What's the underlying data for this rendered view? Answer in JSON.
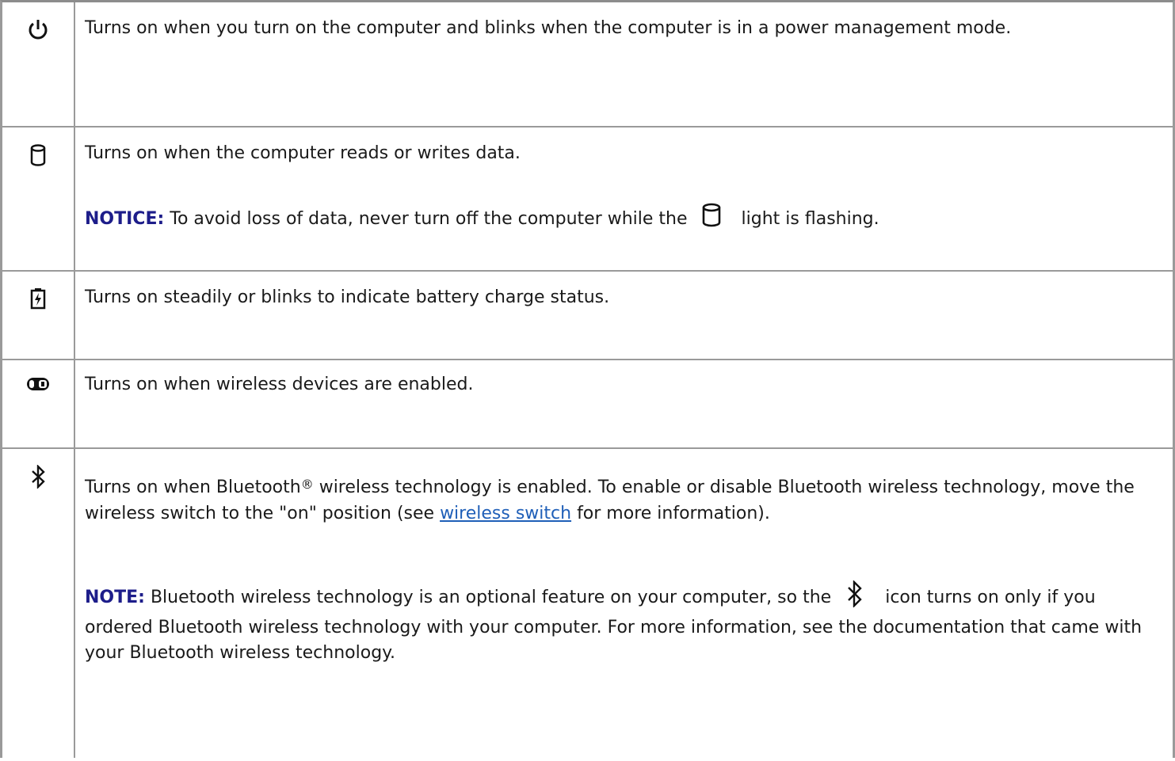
{
  "rows": [
    {
      "icon": "power-icon",
      "text": "Turns on when you turn on the computer and blinks when the computer is in a power management mode."
    },
    {
      "icon": "hard-drive-icon",
      "text": "Turns on when the computer reads or writes data.",
      "notice": {
        "label": "NOTICE:",
        "before": "To avoid loss of data, never turn off the computer while the",
        "inline_icon": "hard-drive-icon",
        "after": "light is flashing."
      }
    },
    {
      "icon": "battery-icon",
      "text": "Turns on steadily or blinks to indicate battery charge status."
    },
    {
      "icon": "wifi-icon",
      "text": "Turns on when wireless devices are enabled."
    },
    {
      "icon": "bluetooth-icon",
      "text_start": "Turns on when Bluetooth",
      "reg_mark": "®",
      "text_mid": "wireless technology is enabled. To enable or disable Bluetooth wireless technology, move the wireless switch to the \"on\" position (see",
      "link_text": "wireless switch",
      "text_end": "for more information).",
      "note": {
        "label": "NOTE:",
        "before": "Bluetooth wireless technology is an optional feature on your computer, so the",
        "inline_icon": "bluetooth-icon",
        "after": "icon turns on only if you ordered Bluetooth wireless technology with your computer. For more information, see the documentation that came with your Bluetooth wireless technology."
      }
    }
  ],
  "colors": {
    "label": "#1d1d8a",
    "link": "#1f5fb8",
    "border": "#9a9a9a"
  }
}
